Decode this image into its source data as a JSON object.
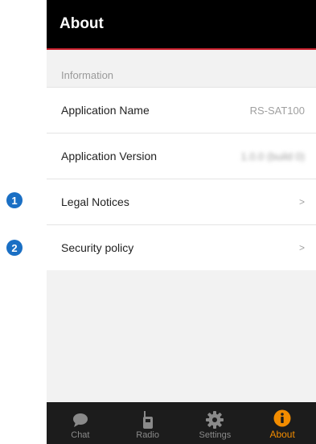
{
  "callouts": [
    "1",
    "2"
  ],
  "header": {
    "title": "About"
  },
  "section": {
    "label": "Information"
  },
  "rows": [
    {
      "label": "Application Name",
      "value": "RS-SAT100"
    },
    {
      "label": "Application Version",
      "value": "1.0.0 (build 0)"
    },
    {
      "label": "Legal Notices",
      "chevron": ">"
    },
    {
      "label": "Security policy",
      "chevron": ">"
    }
  ],
  "tabs": [
    {
      "label": "Chat",
      "icon": "chat-bubble-icon"
    },
    {
      "label": "Radio",
      "icon": "radio-icon"
    },
    {
      "label": "Settings",
      "icon": "gear-icon"
    },
    {
      "label": "About",
      "icon": "info-icon",
      "active": true
    }
  ],
  "colors": {
    "accent": "#f28c00",
    "header_line": "#c8202d",
    "callout": "#1a6fc4"
  }
}
